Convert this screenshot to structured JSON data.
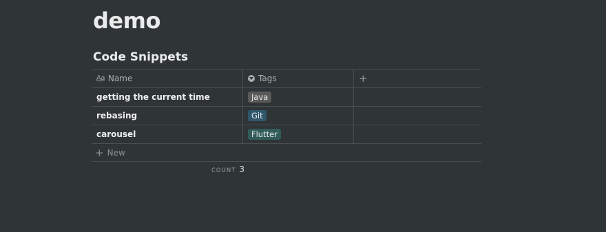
{
  "page": {
    "title": "demo"
  },
  "database": {
    "title": "Code Snippets",
    "columns": {
      "name": {
        "label": "Name",
        "icon": "text-property-icon"
      },
      "tags": {
        "label": "Tags",
        "icon": "select-property-icon"
      },
      "add": {
        "label": "+",
        "icon": "plus-icon"
      }
    },
    "rows": [
      {
        "name": "getting the current time",
        "tag": "Java",
        "tag_color": "#5a5a5a"
      },
      {
        "name": "rebasing",
        "tag": "Git",
        "tag_color": "#31576d"
      },
      {
        "name": "carousel",
        "tag": "Flutter",
        "tag_color": "#315c59"
      }
    ],
    "new_label": "New",
    "new_icon": "+",
    "count_label": "COUNT",
    "count_value": "3"
  },
  "colors": {
    "background": "#2f3437",
    "text": "#e6e6e6"
  }
}
